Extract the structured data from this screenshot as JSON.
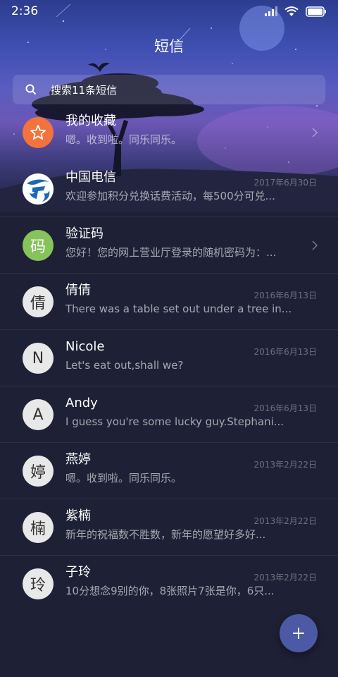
{
  "status_bar": {
    "time": "2:36"
  },
  "header": {
    "title": "短信"
  },
  "search": {
    "placeholder": "搜索11条短信"
  },
  "conversations": [
    {
      "name": "我的收藏",
      "preview": "嗯。收到啦。同乐同乐。",
      "date": "",
      "avatar": "star-icon",
      "avatar_color": "#f4733c",
      "chevron": true
    },
    {
      "name": "中国电信",
      "preview": "欢迎参加积分兑换话费活动，每500分可兑...",
      "date": "2017年6月30日",
      "avatar": "china-telecom-logo",
      "avatar_color": "#ffffff",
      "chevron": false
    },
    {
      "name": "验证码",
      "preview": "您好！您的网上营业厅登录的随机密码为：...",
      "date": "",
      "avatar_text": "码",
      "avatar_color": "#86c35b",
      "chevron": true
    },
    {
      "name": "倩倩",
      "preview": "There was a table set out under a tree in...",
      "date": "2016年6月13日",
      "avatar_text": "倩",
      "avatar_color": "#e8e8e8",
      "chevron": false
    },
    {
      "name": "Nicole",
      "preview": "Let's eat out,shall we?",
      "date": "2016年6月13日",
      "avatar_text": "N",
      "avatar_color": "#e8e8e8",
      "chevron": false
    },
    {
      "name": "Andy",
      "preview": "I guess you're some lucky guy.Stephani...",
      "date": "2016年6月13日",
      "avatar_text": "A",
      "avatar_color": "#e8e8e8",
      "chevron": false
    },
    {
      "name": "燕婷",
      "preview": "嗯。收到啦。同乐同乐。",
      "date": "2013年2月22日",
      "avatar_text": "婷",
      "avatar_color": "#e8e8e8",
      "chevron": false
    },
    {
      "name": "紫楠",
      "preview": "新年的祝福数不胜数，新年的愿望好多好...",
      "date": "2013年2月22日",
      "avatar_text": "楠",
      "avatar_color": "#e8e8e8",
      "chevron": false
    },
    {
      "name": "子玲",
      "preview": "10分想念9别的你，8张照片7张是你，6只...",
      "date": "2013年2月22日",
      "avatar_text": "玲",
      "avatar_color": "#e8e8e8",
      "chevron": false
    }
  ],
  "fab": {
    "icon": "plus-icon"
  }
}
